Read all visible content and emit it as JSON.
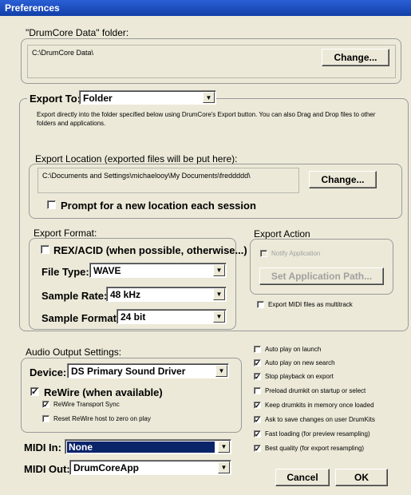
{
  "window": {
    "title": "Preferences"
  },
  "data_folder": {
    "label": "\"DrumCore Data\" folder:",
    "path": "C:\\DrumCore Data\\",
    "change_label": "Change..."
  },
  "export": {
    "to_label": "Export To:",
    "to_value": "Folder",
    "description": "Export directly into the folder specified below using DrumCore's Export button.  You can also Drag and Drop files to other folders and applications.",
    "location_label": "Export Location (exported files will be put here):",
    "location_path": "C:\\Documents and Settings\\michaelooy\\My Documents\\freddddd\\",
    "change_label": "Change...",
    "prompt_label": "Prompt for a new location each session",
    "prompt_checked": false
  },
  "format": {
    "label": "Export Format:",
    "rex_label": "REX/ACID (when possible, otherwise...)",
    "rex_checked": false,
    "file_type_label": "File Type:",
    "file_type": "WAVE",
    "sample_rate_label": "Sample Rate:",
    "sample_rate": "48 kHz",
    "sample_format_label": "Sample Format:",
    "sample_format": "24 bit"
  },
  "action": {
    "label": "Export Action",
    "notify_label": "Notify Application",
    "notify_checked": false,
    "set_path_label": "Set Application Path...",
    "midi_multitrack_label": "Export MIDI files as multitrack",
    "midi_multitrack_checked": false
  },
  "audio": {
    "label": "Audio Output Settings:",
    "device_label": "Device:",
    "device": "DS Primary Sound Driver",
    "rewire_label": "ReWire (when available)",
    "rewire_checked": true,
    "rewire_sync_label": "ReWire Transport Sync",
    "rewire_sync_checked": true,
    "rewire_reset_label": "Reset ReWire host to zero on play",
    "rewire_reset_checked": false
  },
  "midi": {
    "in_label": "MIDI In:",
    "in_value": "None",
    "out_label": "MIDI Out:",
    "out_value": "DrumCoreApp"
  },
  "options": [
    {
      "label": "Auto play on launch",
      "checked": false
    },
    {
      "label": "Auto play on new search",
      "checked": true
    },
    {
      "label": "Stop playback on export",
      "checked": true
    },
    {
      "label": "Preload drumkit on startup or select",
      "checked": false
    },
    {
      "label": "Keep drumkits in memory once loaded",
      "checked": true
    },
    {
      "label": "Ask to save changes on user DrumKits",
      "checked": true
    },
    {
      "label": "Fast loading (for preview resampling)",
      "checked": true
    },
    {
      "label": "Best quality (for export resampling)",
      "checked": true
    }
  ],
  "buttons": {
    "cancel": "Cancel",
    "ok": "OK"
  }
}
